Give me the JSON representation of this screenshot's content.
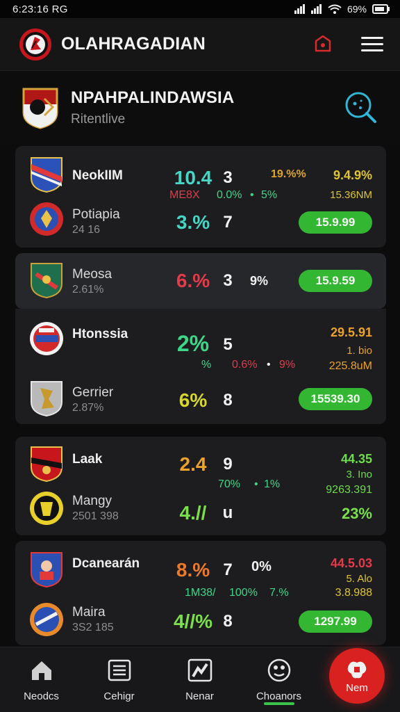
{
  "status_bar": {
    "time": "6:23:16",
    "carrier": "RG",
    "battery": "69%"
  },
  "app": {
    "title": "OLAHRAGADIAN",
    "logo_icon": "app-emblem-icon",
    "notif_icon": "notification-icon",
    "menu_icon": "hamburger-menu-icon"
  },
  "league": {
    "name": "NPAHPALINDAWSIA",
    "subtitle": "Ritentlive",
    "crest_icon": "league-crest-icon",
    "search_icon": "search-icon"
  },
  "colors": {
    "green": "#33b733",
    "red": "#e23b4b",
    "cyan": "#3fd6c9",
    "yellow": "#e0c62e",
    "orange": "#eba32a",
    "lime": "#7be04c",
    "background": "#0c0c0d",
    "card": "#1d1d1f"
  },
  "matches": [
    {
      "home": {
        "name": "NeokIIM",
        "sub": "",
        "score": "10.4",
        "score_color": "#46d6c6",
        "period": "3",
        "crest_icon": "team-crest-icon"
      },
      "mid_stats": {
        "left": "ME8X",
        "center": "0.0%",
        "right": "5%"
      },
      "odds": {
        "top": "19.%%",
        "right": "9.4.9%",
        "sub": "15.36NM"
      },
      "away": {
        "name": "Potiapia",
        "sub": "24 16",
        "score": "3.%",
        "score_color": "#46d6c6",
        "period": "7",
        "pill": "15.9.99",
        "crest_icon": "team-crest-icon"
      }
    },
    {
      "home": {
        "name": "Meosa",
        "sub": "2.61%",
        "score": "6.%",
        "score_color": "#e23b4b",
        "period": "3",
        "extra": "9%",
        "pill": "15.9.59",
        "crest_icon": "team-crest-icon"
      }
    },
    {
      "home": {
        "name": "Htonssia",
        "sub": "",
        "score": "2%",
        "score_color": "#3fd68a",
        "period": "5",
        "crest_icon": "team-crest-icon"
      },
      "mid_stats": {
        "left": "%",
        "center": "0.6%",
        "right": "9%"
      },
      "odds": {
        "right": "29.5.91",
        "sub": "1. bio",
        "sub2": "225.8uM"
      },
      "away": {
        "name": "Gerrier",
        "sub": "2.87%",
        "score": "6%",
        "score_color": "#d7d82c",
        "period": "8",
        "pill": "15539.30",
        "crest_icon": "team-crest-icon"
      }
    },
    {
      "home": {
        "name": "Laak",
        "sub": "",
        "score": "2.4",
        "score_color": "#eba32a",
        "period": "9",
        "crest_icon": "team-crest-icon"
      },
      "mid_stats": {
        "left": "",
        "center": "70%",
        "right": "1%"
      },
      "odds": {
        "right": "44.35",
        "sub": "3. Ino",
        "sub2": "9263.391"
      },
      "away": {
        "name": "Mangy",
        "sub": "2501 398",
        "score": "4.//",
        "score_color": "#7be04c",
        "period": "u",
        "result": "23%",
        "crest_icon": "team-crest-icon"
      }
    },
    {
      "home": {
        "name": "Dcanearán",
        "sub": "",
        "score": "8.%",
        "score_color": "#eb7a2a",
        "period": "7",
        "extra": "0%",
        "crest_icon": "team-crest-icon"
      },
      "mid_stats": {
        "left": "1M38/",
        "center": "100%",
        "right": "7.%"
      },
      "odds": {
        "right": "44.5.03",
        "sub": "5. Alo",
        "sub2": "3.8.988"
      },
      "away": {
        "name": "Maira",
        "sub": "3S2 185",
        "score": "4//%",
        "score_color": "#7be04c",
        "period": "8",
        "pill": "1297.99",
        "crest_icon": "team-crest-icon"
      }
    }
  ],
  "bottom_nav": [
    {
      "label": "Neodcs",
      "icon": "home-icon"
    },
    {
      "label": "Cehigr",
      "icon": "list-icon"
    },
    {
      "label": "Nenar",
      "icon": "chart-icon"
    },
    {
      "label": "Choanors",
      "icon": "trophy-icon"
    },
    {
      "label": "Nem",
      "icon": "live-icon"
    }
  ]
}
